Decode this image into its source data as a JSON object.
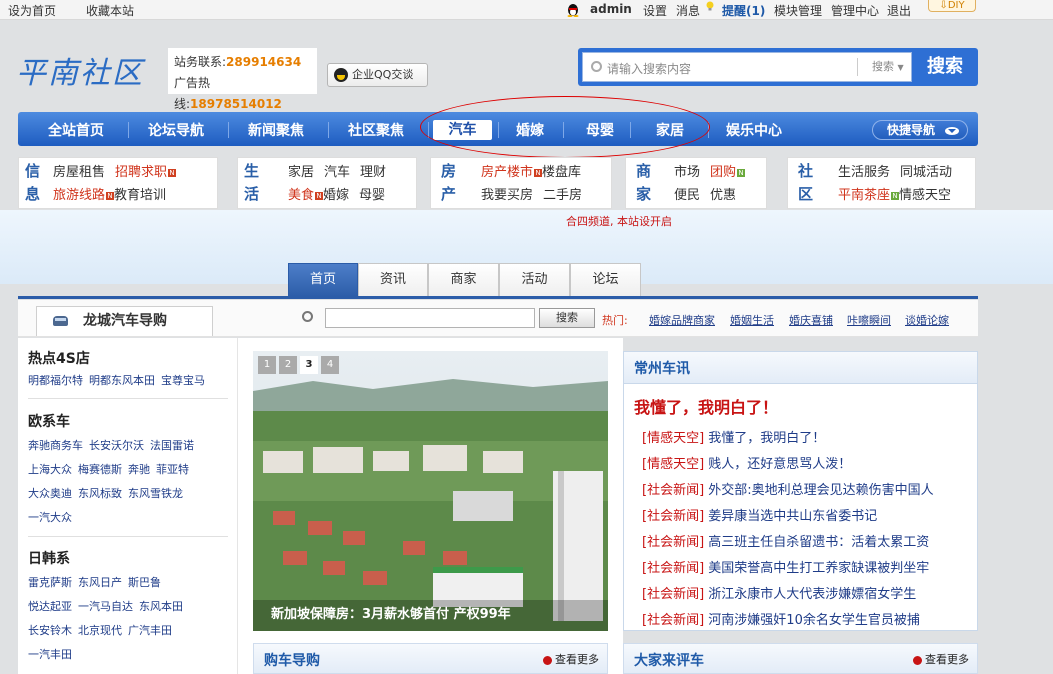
{
  "topbar": {
    "set_home": "设为首页",
    "bookmark": "收藏本站",
    "user": "admin",
    "settings": "设置",
    "messages": "消息",
    "reminder": "提醒(1)",
    "module_manage": "模块管理",
    "admin_center": "管理中心",
    "logout": "退出",
    "diy": "DIY"
  },
  "header": {
    "logo": "平南社区",
    "station_contact_label": "站务联系:",
    "station_contact_value": "289914634",
    "ad_hotline_label": "广告热线:",
    "ad_hotline_value": "18978514012",
    "qq_button": "企业QQ交谈",
    "search_placeholder": "请输入搜索内容",
    "search_select": "搜索",
    "search_button": "搜索"
  },
  "nav": {
    "items": [
      "全站首页",
      "论坛导航",
      "新闻聚焦",
      "社区聚焦",
      "汽车",
      "婚嫁",
      "母婴",
      "家居",
      "娱乐中心"
    ],
    "quick_nav": "快捷导航"
  },
  "categories": [
    {
      "title": "信息",
      "row1": [
        "房屋租售",
        "招聘求职"
      ],
      "row2": [
        "旅游线路",
        "教育培训"
      ]
    },
    {
      "title": "生活",
      "row1": [
        "家居",
        "汽车",
        "理财"
      ],
      "row2": [
        "美食",
        "婚嫁",
        "母婴"
      ]
    },
    {
      "title": "房产",
      "row1": [
        "房产楼市",
        "楼盘库"
      ],
      "row2": [
        "我要买房",
        "二手房"
      ]
    },
    {
      "title": "商家",
      "row1": [
        "市场",
        "团购"
      ],
      "row2": [
        "便民",
        "优惠"
      ]
    },
    {
      "title": "社区",
      "row1": [
        "生活服务",
        "同城活动"
      ],
      "row2": [
        "平南茶座",
        "情感天空"
      ]
    }
  ],
  "annotation": "合四频道, 本站设开启",
  "tabs": [
    "首页",
    "资讯",
    "商家",
    "活动",
    "论坛"
  ],
  "subbar": {
    "brand": "龙城汽车导购",
    "search_button": "搜索",
    "hot_label": "热门:",
    "hot_links": [
      "婚嫁品牌商家",
      "婚姻生活",
      "婚庆喜铺",
      "咔嚓瞬间",
      "谈婚论嫁"
    ]
  },
  "sidebar": {
    "hot4s_title": "热点4S店",
    "hot4s": [
      "明都福尔特",
      "明都东风本田",
      "宝尊宝马"
    ],
    "europe_title": "欧系车",
    "europe_rows": [
      [
        "奔驰商务车",
        "长安沃尔沃",
        "法国雷诺"
      ],
      [
        "上海大众",
        "梅赛德斯",
        "奔驰",
        "菲亚特"
      ],
      [
        "大众奥迪",
        "东风标致",
        "东风雪铁龙"
      ],
      [
        "一汽大众"
      ]
    ],
    "japan_title": "日韩系",
    "japan_rows": [
      [
        "雷克萨斯",
        "东风日产",
        "斯巴鲁"
      ],
      [
        "悦达起亚",
        "一汽马自达",
        "东风本田"
      ],
      [
        "长安铃木",
        "北京现代",
        "广汽丰田"
      ],
      [
        "一汽丰田"
      ]
    ]
  },
  "slideshow": {
    "pages": [
      "1",
      "2",
      "3",
      "4"
    ],
    "active_page": "3",
    "caption": "新加坡保障房：3月薪水够首付 产权99年"
  },
  "buy_guide": {
    "title": "购车导购",
    "more": "查看更多"
  },
  "news": {
    "title": "常州车讯",
    "headline": "我懂了，我明白了！",
    "items": [
      {
        "cat": "[情感天空]",
        "text": "我懂了，我明白了！"
      },
      {
        "cat": "[情感天空]",
        "text": "贱人，还好意思骂人泼！"
      },
      {
        "cat": "[社会新闻]",
        "text": "外交部:奥地利总理会见达赖伤害中国人"
      },
      {
        "cat": "[社会新闻]",
        "text": "姜异康当选中共山东省委书记"
      },
      {
        "cat": "[社会新闻]",
        "text": "高三班主任自杀留遗书：活着太累工资"
      },
      {
        "cat": "[社会新闻]",
        "text": "美国荣誉高中生打工养家缺课被判坐牢"
      },
      {
        "cat": "[社会新闻]",
        "text": "浙江永康市人大代表涉嫌嫖宿女学生"
      },
      {
        "cat": "[社会新闻]",
        "text": "河南涉嫌强奸10余名女学生官员被捕"
      }
    ]
  },
  "reviews": {
    "title": "大家来评车",
    "more": "查看更多"
  },
  "colors": {
    "brand_blue": "#2e6fd4",
    "nav_blue": "#1e5cc0",
    "accent_red": "#c81414",
    "orange": "#e67e00"
  }
}
